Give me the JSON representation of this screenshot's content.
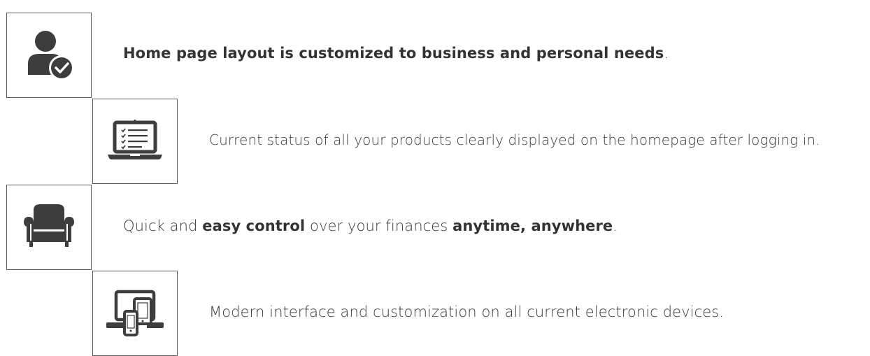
{
  "features": [
    {
      "icon": "user-check-icon",
      "parts": [
        {
          "text": "Home page layout is customized to business and personal needs",
          "bold": true
        },
        {
          "text": ".",
          "bold": false
        }
      ]
    },
    {
      "icon": "laptop-checklist-icon",
      "parts": [
        {
          "text": "Current status of all your products clearly displayed on the homepage after logging in.",
          "bold": false
        }
      ]
    },
    {
      "icon": "armchair-icon",
      "parts": [
        {
          "text": "Quick and ",
          "bold": false
        },
        {
          "text": "easy control",
          "bold": true
        },
        {
          "text": " over your finances ",
          "bold": false
        },
        {
          "text": "anytime, anywhere",
          "bold": true
        },
        {
          "text": ".",
          "bold": false
        }
      ]
    },
    {
      "icon": "devices-icon",
      "parts": [
        {
          "text": "Modern interface and customization on all current electronic devices.",
          "bold": false
        }
      ]
    }
  ],
  "colors": {
    "text": "#3a3a3a",
    "icon": "#3d3d3d",
    "border": "#5a5a5a"
  }
}
